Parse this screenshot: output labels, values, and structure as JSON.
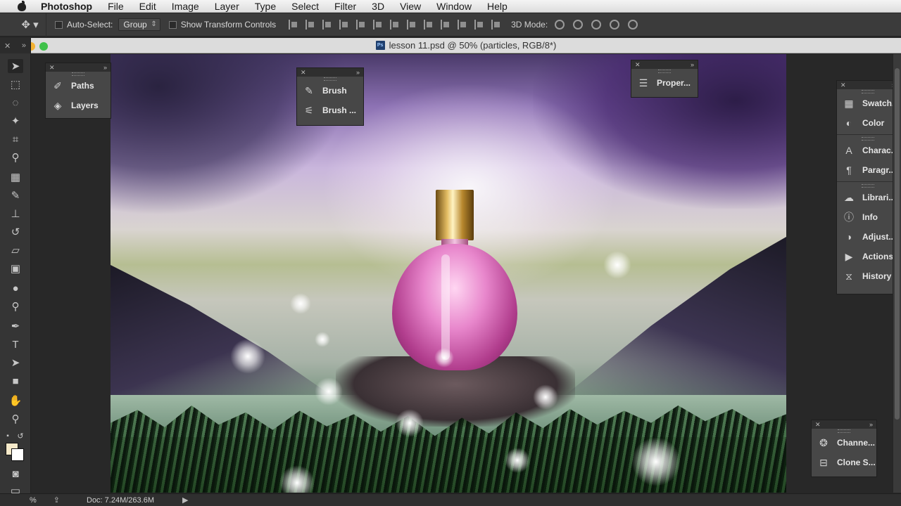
{
  "menubar": {
    "app_name": "Photoshop",
    "items": [
      "File",
      "Edit",
      "Image",
      "Layer",
      "Type",
      "Select",
      "Filter",
      "3D",
      "View",
      "Window",
      "Help"
    ]
  },
  "options_bar": {
    "auto_select_label": "Auto-Select:",
    "auto_select_value": "Group",
    "show_transform_label": "Show Transform Controls",
    "mode_3d_label": "3D Mode:"
  },
  "document": {
    "title": "lesson 11.psd @ 50% (particles, RGB/8*)",
    "ps_badge": "Ps"
  },
  "panels": {
    "left": [
      {
        "label": "Paths",
        "icon": "paths-icon"
      },
      {
        "label": "Layers",
        "icon": "layers-icon"
      }
    ],
    "brush": [
      {
        "label": "Brush",
        "icon": "brush-icon"
      },
      {
        "label": "Brush ...",
        "icon": "brush-presets-icon"
      }
    ],
    "properties": [
      {
        "label": "Proper...",
        "icon": "properties-icon"
      }
    ],
    "right_group1": [
      {
        "label": "Swatch...",
        "icon": "swatches-icon"
      },
      {
        "label": "Color",
        "icon": "color-icon"
      }
    ],
    "right_group2": [
      {
        "label": "Charac...",
        "icon": "character-icon"
      },
      {
        "label": "Paragr...",
        "icon": "paragraph-icon"
      }
    ],
    "right_group3": [
      {
        "label": "Librari...",
        "icon": "libraries-icon"
      },
      {
        "label": "Info",
        "icon": "info-icon"
      },
      {
        "label": "Adjust...",
        "icon": "adjustments-icon"
      },
      {
        "label": "Actions",
        "icon": "actions-icon"
      },
      {
        "label": "History",
        "icon": "history-icon"
      }
    ],
    "bottom_right": [
      {
        "label": "Channe...",
        "icon": "channels-icon"
      },
      {
        "label": "Clone S...",
        "icon": "clone-source-icon"
      }
    ]
  },
  "status": {
    "zoom": "%",
    "doc_size": "Doc: 7.24M/263.6M"
  },
  "colors": {
    "foreground": "#f5e9c9",
    "background": "#ffffff"
  }
}
